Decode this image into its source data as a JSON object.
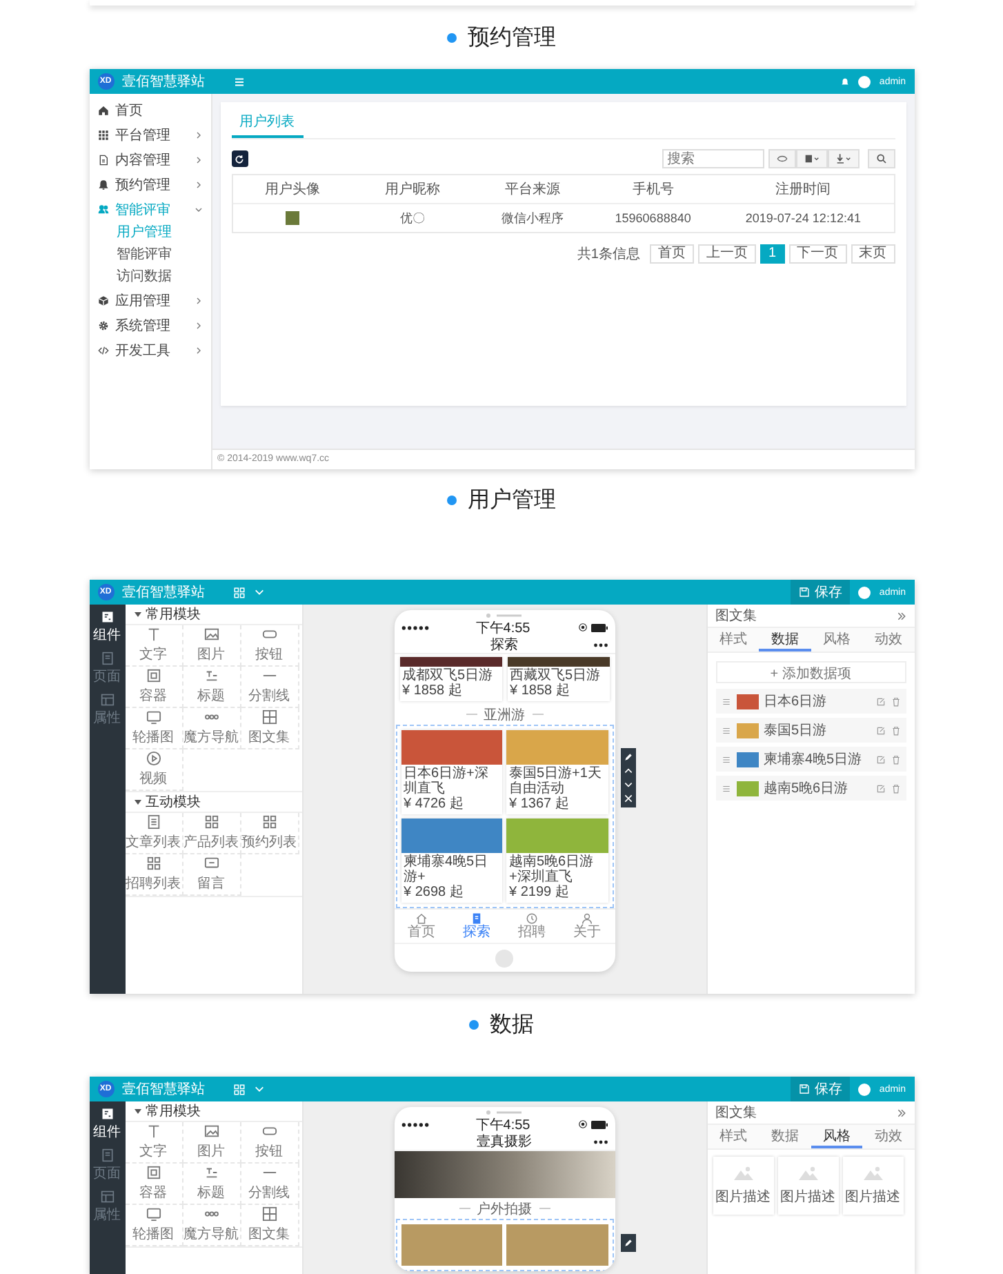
{
  "caption_top": "预约管理",
  "admin": {
    "logo": "XD",
    "brand": "壹佰智慧驿站",
    "user": "admin",
    "sidebar": [
      {
        "kind": "home",
        "label": "首页",
        "selected": false
      },
      {
        "kind": "grid",
        "label": "平台管理",
        "selected": false,
        "expanded": false
      },
      {
        "kind": "doc",
        "label": "内容管理",
        "selected": false,
        "expanded": false
      },
      {
        "kind": "bell",
        "label": "预约管理",
        "selected": false,
        "expanded": false
      },
      {
        "kind": "users",
        "label": "智能评审",
        "selected": true,
        "expanded": true,
        "children": [
          {
            "label": "用户管理",
            "selected": true
          },
          {
            "label": "智能评审",
            "selected": false
          },
          {
            "label": "访问数据",
            "selected": false
          }
        ]
      },
      {
        "kind": "cube",
        "label": "应用管理",
        "selected": false,
        "expanded": false
      },
      {
        "kind": "gear",
        "label": "系统管理",
        "selected": false,
        "expanded": false
      },
      {
        "kind": "code",
        "label": "开发工具",
        "selected": false,
        "expanded": false
      }
    ],
    "tabs": [
      {
        "label": "用户列表",
        "selected": true
      }
    ],
    "search": {
      "placeholder": "搜索"
    },
    "table": {
      "columns": [
        "用户头像",
        "用户昵称",
        "平台来源",
        "手机号",
        "注册时间"
      ],
      "rows": [
        {
          "nickname": "优〇",
          "source": "微信小程序",
          "phone": "15960688840",
          "registered": "2019-07-24 12:12:41"
        }
      ]
    },
    "pagination": {
      "info": "共1条信息",
      "pages": [
        {
          "label": "首页",
          "selected": false
        },
        {
          "label": "上一页",
          "selected": false
        },
        {
          "label": "1",
          "selected": true
        },
        {
          "label": "下一页",
          "selected": false
        },
        {
          "label": "末页",
          "selected": false
        }
      ]
    },
    "footer": "© 2014-2019 www.wq7.cc"
  },
  "caption_2": "用户管理",
  "editor": {
    "logo": "XD",
    "brand": "壹佰智慧驿站",
    "save": "保存",
    "user": "admin",
    "rail": [
      {
        "kind": "component",
        "label": "组件",
        "selected": true
      },
      {
        "kind": "page",
        "label": "页面",
        "selected": false
      },
      {
        "kind": "attr",
        "label": "属性",
        "selected": false
      }
    ],
    "widget_groups": [
      {
        "title": "常用模块",
        "expanded": true,
        "items": [
          {
            "kind": "text",
            "label": "文字"
          },
          {
            "kind": "image",
            "label": "图片"
          },
          {
            "kind": "button",
            "label": "按钮"
          },
          {
            "kind": "container",
            "label": "容器"
          },
          {
            "kind": "title",
            "label": "标题"
          },
          {
            "kind": "divider",
            "label": "分割线"
          },
          {
            "kind": "carousel",
            "label": "轮播图"
          },
          {
            "kind": "cube",
            "label": "魔方导航"
          },
          {
            "kind": "gallery",
            "label": "图文集"
          },
          {
            "kind": "video",
            "label": "视频"
          }
        ]
      },
      {
        "title": "互动模块",
        "expanded": true,
        "items": [
          {
            "kind": "article",
            "label": "文章列表"
          },
          {
            "kind": "grid",
            "label": "产品列表"
          },
          {
            "kind": "grid",
            "label": "预约列表"
          },
          {
            "kind": "grid",
            "label": "招聘列表"
          },
          {
            "kind": "message",
            "label": "留言"
          }
        ]
      }
    ],
    "phone": {
      "time": "下午4:55",
      "title": "探索",
      "top_cards": [
        {
          "name": "成都双飞5日游",
          "price": "¥ 1858 起"
        },
        {
          "name": "西藏双飞5日游",
          "price": "¥ 1858 起"
        }
      ],
      "section": "亚洲游",
      "cards": [
        {
          "name": "日本6日游+深圳直飞",
          "price": "¥ 4726 起"
        },
        {
          "name": "泰国5日游+1天自由活动",
          "price": "¥ 1367 起"
        },
        {
          "name": "柬埔寨4晚5日游+",
          "price": "¥ 2698 起"
        },
        {
          "name": "越南5晚6日游+深圳直飞",
          "price": "¥ 2199 起"
        }
      ],
      "tabbar": [
        {
          "kind": "home",
          "label": "首页",
          "selected": false
        },
        {
          "kind": "explore",
          "label": "探索",
          "selected": true
        },
        {
          "kind": "clock",
          "label": "招聘",
          "selected": false
        },
        {
          "kind": "person",
          "label": "关于",
          "selected": false
        }
      ]
    },
    "panel": {
      "title": "图文集",
      "tabs": [
        {
          "label": "样式",
          "selected": false
        },
        {
          "label": "数据",
          "selected": true
        },
        {
          "label": "风格",
          "selected": false
        },
        {
          "label": "动效",
          "selected": false
        }
      ],
      "add": "+ 添加数据项",
      "items": [
        "日本6日游",
        "泰国5日游",
        "柬埔寨4晚5日游",
        "越南5晚6日游"
      ]
    }
  },
  "caption_3": "数据",
  "editor_2": {
    "logo": "XD",
    "brand": "壹佰智慧驿站",
    "save": "保存",
    "user": "admin",
    "rail": [
      {
        "kind": "component",
        "label": "组件",
        "selected": true
      },
      {
        "kind": "page",
        "label": "页面",
        "selected": false
      },
      {
        "kind": "attr",
        "label": "属性",
        "selected": false
      }
    ],
    "widget_groups": [
      {
        "title": "常用模块",
        "expanded": true,
        "items": [
          {
            "kind": "text",
            "label": "文字"
          },
          {
            "kind": "image",
            "label": "图片"
          },
          {
            "kind": "button",
            "label": "按钮"
          },
          {
            "kind": "container",
            "label": "容器"
          },
          {
            "kind": "title",
            "label": "标题"
          },
          {
            "kind": "divider",
            "label": "分割线"
          },
          {
            "kind": "carousel",
            "label": "轮播图"
          },
          {
            "kind": "cube",
            "label": "魔方导航"
          },
          {
            "kind": "gallery",
            "label": "图文集"
          }
        ]
      }
    ],
    "phone": {
      "time": "下午4:55",
      "title": "壹真摄影",
      "section": "户外拍摄"
    },
    "panel": {
      "title": "图文集",
      "tabs": [
        {
          "label": "样式",
          "selected": false
        },
        {
          "label": "数据",
          "selected": false
        },
        {
          "label": "风格",
          "selected": true
        },
        {
          "label": "动效",
          "selected": false
        }
      ],
      "styles": [
        "图片描述",
        "图片描述",
        "图片描述"
      ]
    }
  }
}
